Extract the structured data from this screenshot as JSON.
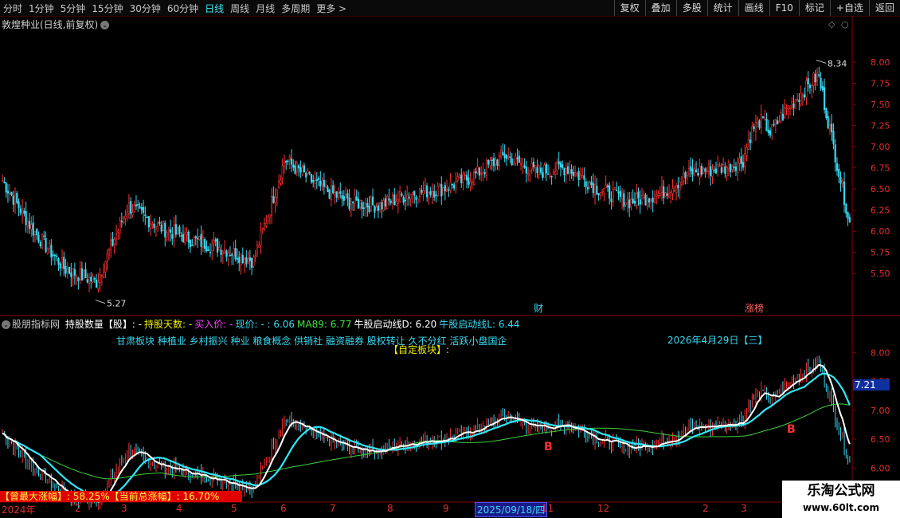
{
  "toolbar": {
    "timeframes": [
      "分时",
      "1分钟",
      "5分钟",
      "15分钟",
      "30分钟",
      "60分钟",
      "日线",
      "周线",
      "月线",
      "多周期",
      "更多 >"
    ],
    "active_timeframe": "日线",
    "tools": [
      "复权",
      "叠加",
      "多股",
      "统计",
      "画线",
      "F10",
      "标记",
      "+自选",
      "返回"
    ]
  },
  "chart1": {
    "title": "敦煌种业(日线,前复权)",
    "high_label": "8.34",
    "low_label": "5.27",
    "badges": [
      {
        "text": "财",
        "color": "#38d8f0"
      },
      {
        "text": "涨榜",
        "color": "#ff6060"
      }
    ],
    "axis_ticks": [
      "8.00",
      "7.75",
      "7.50",
      "7.25",
      "7.00",
      "6.75",
      "6.50",
      "6.25",
      "6.00",
      "5.75",
      "5.50"
    ]
  },
  "indicator": {
    "name": "股朋指标网",
    "parts": [
      {
        "text": "持股数量【股】: -",
        "color": "#ffffff"
      },
      {
        "text": "持股天数: -",
        "color": "#f0f000"
      },
      {
        "text": "买入价: -",
        "color": "#ff40ff"
      },
      {
        "text": "现价: - : 6.06",
        "color": "#38d8f0"
      },
      {
        "text": "MA89: 6.77",
        "color": "#40e040"
      },
      {
        "text": "牛股启动线D: 6.20",
        "color": "#ffffff"
      },
      {
        "text": "牛股启动线L: 6.44",
        "color": "#38d8f0"
      }
    ],
    "tags": [
      "甘肃板块",
      "种植业",
      "乡村振兴",
      "种业",
      "粮食概念",
      "供销社",
      "融资融券",
      "股权转让",
      "久不分红",
      "活跃小盘国企"
    ],
    "custom_block": "【自定板块】:",
    "date_note": "2026年4月29日【三】",
    "gain_text": "【曾最大涨幅】: 58.25%【当前总涨幅】: 16.70%",
    "current_price_tag": "7.21",
    "b_marks": [
      "B",
      "B"
    ],
    "axis_ticks": [
      "8.00",
      "7.50",
      "7.00",
      "6.50",
      "6.00"
    ]
  },
  "xaxis": {
    "labels": [
      "2024年",
      "2",
      "3",
      "4",
      "5",
      "6",
      "7",
      "8",
      "9",
      "2025/09/18/四",
      "11",
      "12",
      "2",
      "3"
    ],
    "highlight": "2025/09/18/四"
  },
  "watermark": {
    "line1": "乐淘公式网",
    "line2": "www.60lt.com"
  },
  "colors": {
    "up": "#ff3030",
    "down": "#38d8f0",
    "ma_white": "#ffffff",
    "ma_cyan": "#30e8f8",
    "ma_green": "#40d040",
    "axis": "#8a0000"
  },
  "chart_data": {
    "type": "line",
    "x": [
      "2024-01",
      "2024-02",
      "2024-03",
      "2024-04",
      "2024-05",
      "2024-06",
      "2024-07",
      "2024-08",
      "2024-09",
      "2024-10",
      "2024-11",
      "2024-12",
      "2025-01",
      "2025-02",
      "2025-03",
      "2025-04",
      "2025-05",
      "2025-06",
      "2025-07",
      "2025-08",
      "2025-09",
      "2025-10",
      "2025-11",
      "2025-12",
      "2026-01",
      "2026-02",
      "2026-03",
      "2026-04"
    ],
    "series": [
      {
        "values": [
          6.6,
          6.0,
          5.55,
          5.4,
          6.3,
          6.05,
          5.9,
          5.8,
          5.65,
          6.85,
          6.55,
          6.35,
          6.3,
          6.45,
          6.5,
          6.65,
          6.9,
          6.7,
          6.75,
          6.5,
          6.35,
          6.45,
          6.7,
          6.75,
          6.9,
          7.45,
          7.85,
          6.1
        ]
      }
    ],
    "ylim": [
      5.2,
      8.5
    ]
  }
}
